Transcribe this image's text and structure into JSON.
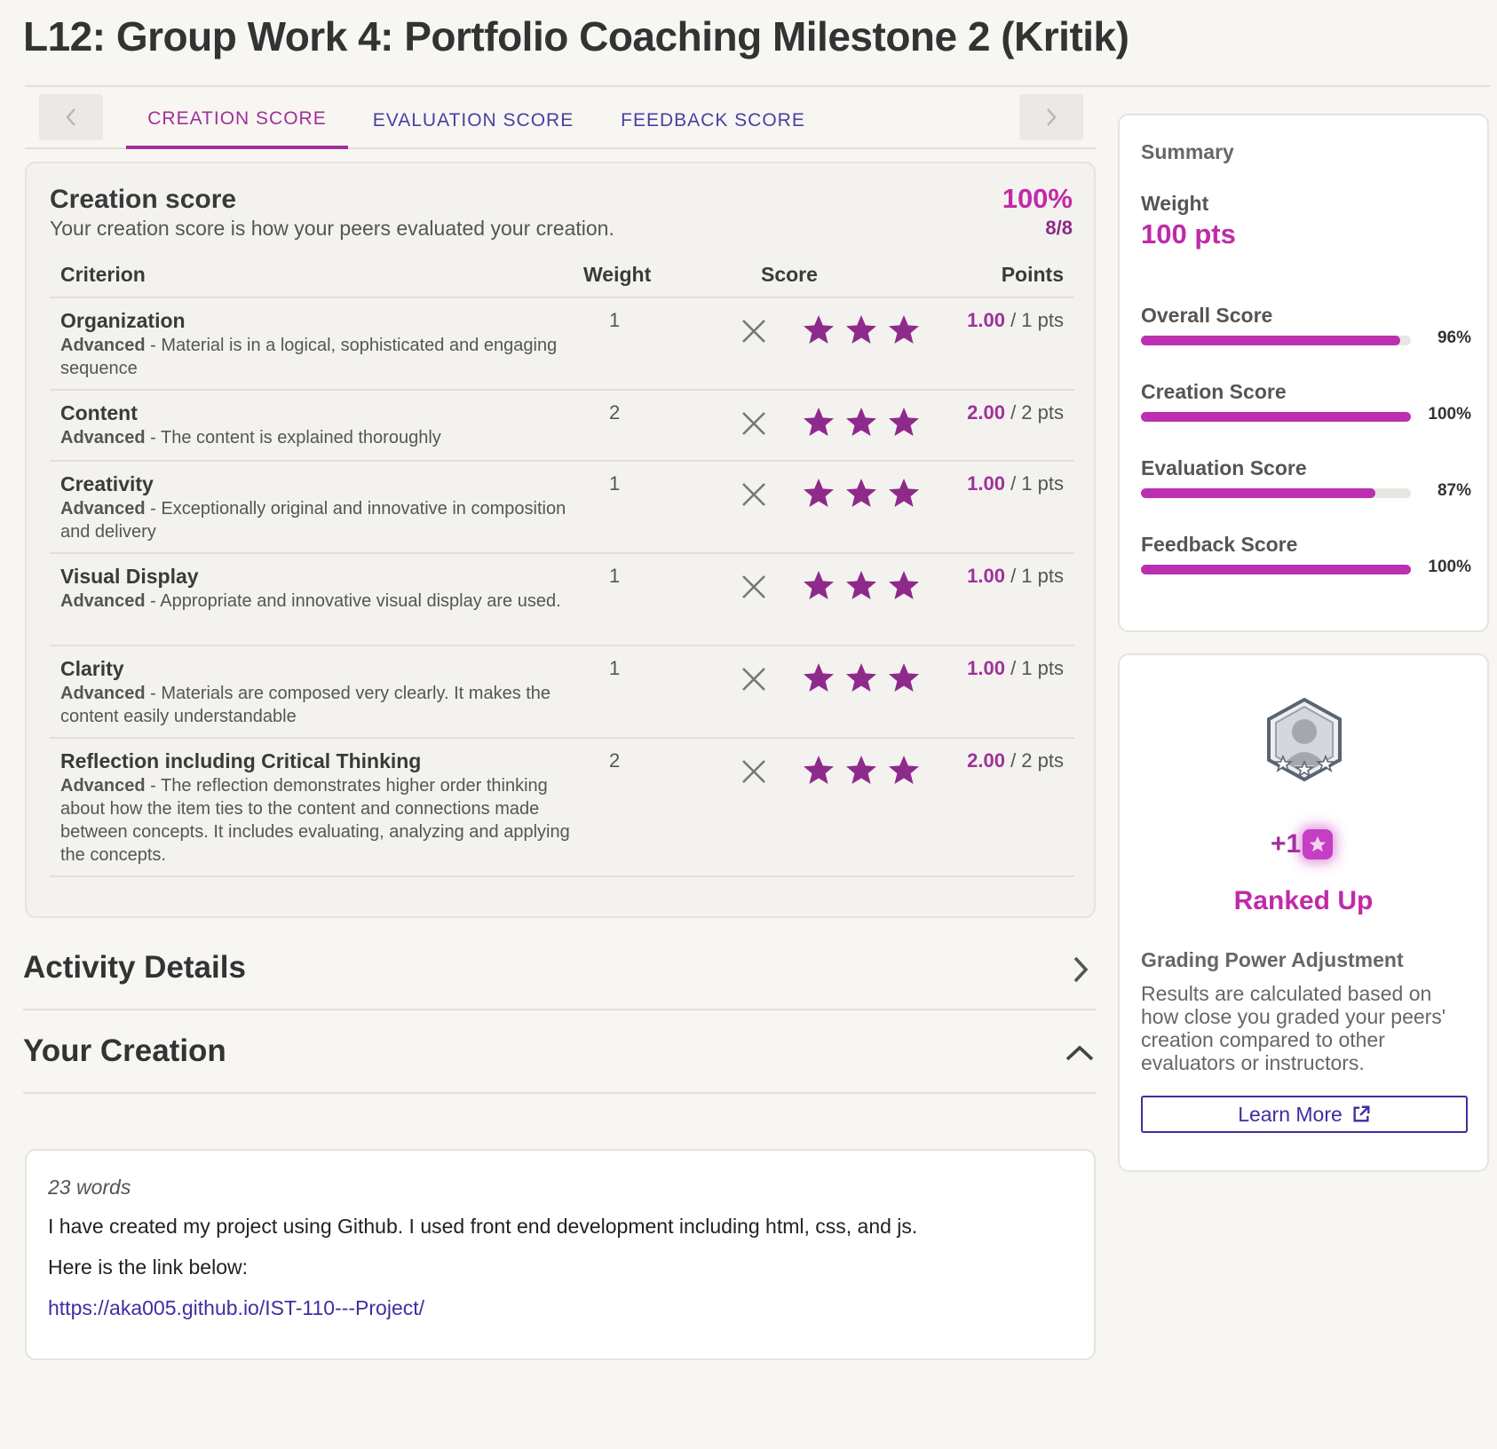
{
  "page": {
    "title": "L12: Group Work 4: Portfolio Coaching Milestone 2 (Kritik)"
  },
  "tabs": [
    {
      "label": "CREATION SCORE",
      "active": true
    },
    {
      "label": "EVALUATION SCORE",
      "active": false
    },
    {
      "label": "FEEDBACK SCORE",
      "active": false
    }
  ],
  "creation_score": {
    "heading": "Creation score",
    "description": "Your creation score is how your peers evaluated your creation.",
    "percent": "100%",
    "fraction": "8/8",
    "columns": {
      "criterion": "Criterion",
      "weight": "Weight",
      "score": "Score",
      "points": "Points"
    },
    "rows": [
      {
        "name": "Organization",
        "level": "Advanced",
        "desc": " - Material is in a logical, sophisticated and engaging sequence",
        "weight": "1",
        "stars": 3,
        "earned": "1.00",
        "total": " / 1 pts"
      },
      {
        "name": "Content",
        "level": "Advanced",
        "desc": " - The content is explained thoroughly",
        "weight": "2",
        "stars": 3,
        "earned": "2.00",
        "total": " / 2 pts"
      },
      {
        "name": "Creativity",
        "level": "Advanced",
        "desc": " - Exceptionally original and innovative in composition and delivery",
        "weight": "1",
        "stars": 3,
        "earned": "1.00",
        "total": " / 1 pts"
      },
      {
        "name": "Visual Display",
        "level": "Advanced",
        "desc": " - Appropriate and innovative visual display are used.",
        "weight": "1",
        "stars": 3,
        "earned": "1.00",
        "total": " / 1 pts"
      },
      {
        "name": "Clarity",
        "level": "Advanced",
        "desc": " - Materials are composed very clearly. It makes the content easily understandable",
        "weight": "1",
        "stars": 3,
        "earned": "1.00",
        "total": " / 1 pts"
      },
      {
        "name": "Reflection including Critical Thinking",
        "level": "Advanced",
        "desc": " - The reflection demonstrates higher order thinking about how the item ties to the content and connections made between concepts. It includes evaluating, analyzing and applying the concepts.",
        "weight": "2",
        "stars": 3,
        "earned": "2.00",
        "total": " / 2 pts"
      }
    ]
  },
  "sections": {
    "activity_details": "Activity Details",
    "your_creation": "Your Creation"
  },
  "creation": {
    "word_count": "23 words",
    "paragraph1": "I have created my project using Github. I used front end development including html, css, and js.",
    "paragraph2": "Here is the link below:",
    "link": "https://aka005.github.io/IST-110---Project/"
  },
  "summary": {
    "title": "Summary",
    "weight_label": "Weight",
    "weight_value": "100 pts",
    "bars": [
      {
        "label": "Overall Score",
        "value": 96,
        "text": "96%"
      },
      {
        "label": "Creation Score",
        "value": 100,
        "text": "100%"
      },
      {
        "label": "Evaluation Score",
        "value": 87,
        "text": "87%"
      },
      {
        "label": "Feedback Score",
        "value": 100,
        "text": "100%"
      }
    ]
  },
  "rank": {
    "plus": "+1",
    "title": "Ranked Up",
    "gp_title": "Grading Power Adjustment",
    "gp_desc": "Results are calculated based on how close you graded your peers' creation compared to other evaluators or instructors.",
    "learn_more": "Learn More"
  },
  "colors": {
    "accent": "#c02aa8",
    "star": "#8e2a8c",
    "link": "#3d2fa0"
  }
}
